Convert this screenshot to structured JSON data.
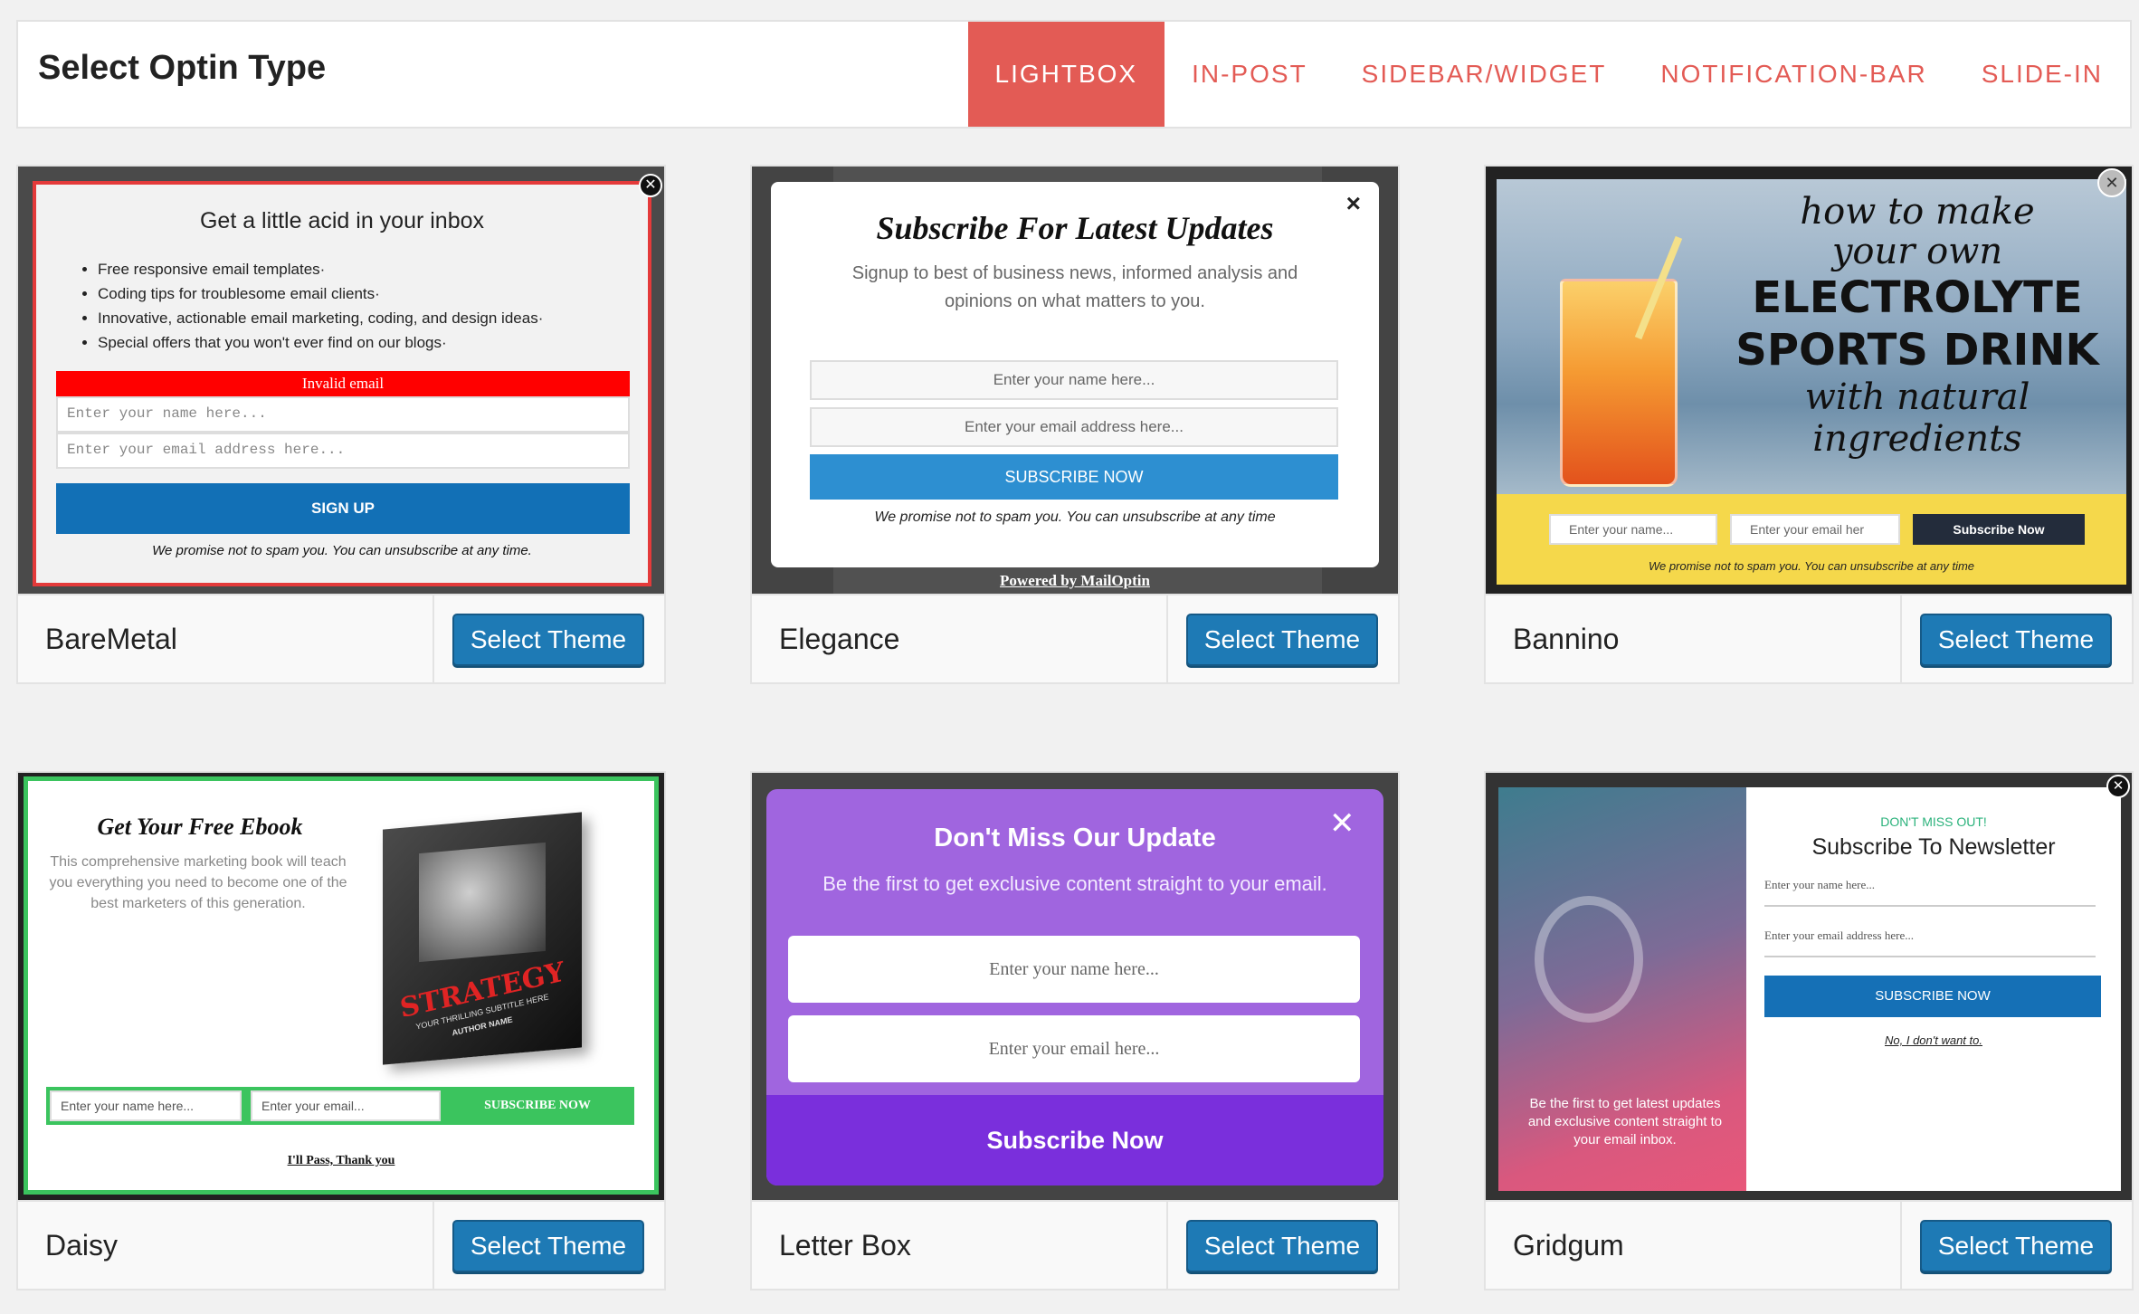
{
  "header": {
    "title": "Select Optin Type",
    "tabs": [
      "LIGHTBOX",
      "IN-POST",
      "SIDEBAR/WIDGET",
      "NOTIFICATION-BAR",
      "SLIDE-IN"
    ]
  },
  "select_label": "Select Theme",
  "themes": {
    "baremetal": {
      "name": "BareMetal",
      "heading": "Get a little acid in your inbox",
      "bullets": [
        "Free responsive email templates·",
        "Coding tips for troublesome email clients·",
        "Innovative, actionable email marketing, coding, and design ideas·",
        "Special offers that you won't ever find on our blogs·"
      ],
      "error": "Invalid email",
      "name_ph": "Enter your name here...",
      "email_ph": "Enter your email address here...",
      "button": "SIGN UP",
      "note": "We promise not to spam you. You can unsubscribe at any time."
    },
    "elegance": {
      "name": "Elegance",
      "heading": "Subscribe For Latest Updates",
      "desc": "Signup to best of business news, informed analysis and opinions on what matters to you.",
      "name_ph": "Enter your name here...",
      "email_ph": "Enter your email address here...",
      "button": "SUBSCRIBE NOW",
      "note": "We promise not to spam you. You can unsubscribe at any time",
      "powered": "Powered by MailOptin"
    },
    "bannino": {
      "name": "Bannino",
      "line1": "how to make",
      "line2": "your own",
      "line3": "ELECTROLYTE",
      "line4": "SPORTS DRINK",
      "line5": "with natural",
      "line6": "ingredients",
      "name_ph": "Enter your name...",
      "email_ph": "Enter your email her",
      "button": "Subscribe Now",
      "note": "We promise not to spam you. You can unsubscribe at any time"
    },
    "daisy": {
      "name": "Daisy",
      "heading": "Get Your Free Ebook",
      "desc": "This comprehensive marketing book will teach you everything you need to become one of the best marketers of this generation.",
      "book_title": "STRATEGY",
      "book_sub": "YOUR THRILLING SUBTITLE HERE",
      "book_author": "AUTHOR NAME",
      "name_ph": "Enter your name here...",
      "email_ph": "Enter your email...",
      "button": "SUBSCRIBE NOW",
      "pass": "I'll Pass, Thank you"
    },
    "letterbox": {
      "name": "Letter Box",
      "heading": "Don't Miss Our Update",
      "desc": "Be the first to get exclusive content straight to your email.",
      "name_ph": "Enter your name here...",
      "email_ph": "Enter your email here...",
      "button": "Subscribe Now"
    },
    "gridgum": {
      "name": "Gridgum",
      "kicker": "DON'T MISS OUT!",
      "heading": "Subscribe To Newsletter",
      "name_ph": "Enter your name here...",
      "email_ph": "Enter your email address here...",
      "button": "SUBSCRIBE NOW",
      "decline": "No, I don't want to.",
      "side_text": "Be the first to get latest updates and exclusive content straight to your email inbox."
    }
  }
}
